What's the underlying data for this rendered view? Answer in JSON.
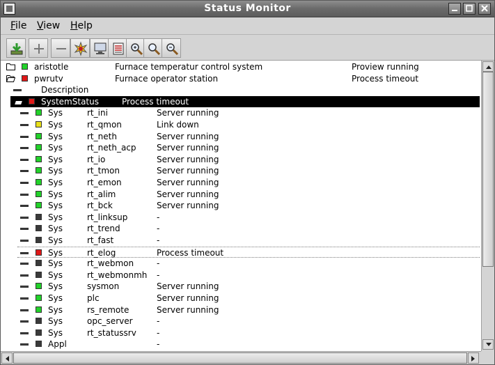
{
  "window": {
    "title": "Status Monitor"
  },
  "menu": {
    "file_label": "File",
    "view_label": "View",
    "help_label": "Help"
  },
  "toolbar": {
    "icons": [
      "save-icon",
      "add-icon",
      "remove-icon",
      "event-icon",
      "node-display-icon",
      "history-icon",
      "zoom-in-icon",
      "zoom-reset-icon",
      "zoom-out-icon"
    ]
  },
  "colors": {
    "green": "#22d22a",
    "red": "#e01818",
    "yellow": "#e8e01a",
    "gray": "#3a3a3a"
  },
  "nodes": [
    {
      "name": "aristotle",
      "description": "Furnace temperatur control system",
      "status": "Proview running",
      "color": "green",
      "expanded": false
    },
    {
      "name": "pwrutv",
      "description": "Furnace operator station",
      "status": "Process timeout",
      "color": "red",
      "expanded": true
    }
  ],
  "description_label": "Description",
  "system_status": {
    "label": "SystemStatus",
    "status": "Process timeout",
    "color": "red"
  },
  "servers": [
    {
      "type": "Sys",
      "name": "rt_ini",
      "status": "Server running",
      "color": "green"
    },
    {
      "type": "Sys",
      "name": "rt_qmon",
      "status": "Link down",
      "color": "yellow"
    },
    {
      "type": "Sys",
      "name": "rt_neth",
      "status": "Server running",
      "color": "green"
    },
    {
      "type": "Sys",
      "name": "rt_neth_acp",
      "status": "Server running",
      "color": "green"
    },
    {
      "type": "Sys",
      "name": "rt_io",
      "status": "Server running",
      "color": "green"
    },
    {
      "type": "Sys",
      "name": "rt_tmon",
      "status": "Server running",
      "color": "green"
    },
    {
      "type": "Sys",
      "name": "rt_emon",
      "status": "Server running",
      "color": "green"
    },
    {
      "type": "Sys",
      "name": "rt_alim",
      "status": "Server running",
      "color": "green"
    },
    {
      "type": "Sys",
      "name": "rt_bck",
      "status": "Server running",
      "color": "green"
    },
    {
      "type": "Sys",
      "name": "rt_linksup",
      "status": "-",
      "color": "gray"
    },
    {
      "type": "Sys",
      "name": "rt_trend",
      "status": "-",
      "color": "gray"
    },
    {
      "type": "Sys",
      "name": "rt_fast",
      "status": "-",
      "color": "gray"
    },
    {
      "type": "Sys",
      "name": "rt_elog",
      "status": "Process timeout",
      "color": "red",
      "focused": true
    },
    {
      "type": "Sys",
      "name": "rt_webmon",
      "status": "-",
      "color": "gray"
    },
    {
      "type": "Sys",
      "name": "rt_webmonmh",
      "status": "-",
      "color": "gray"
    },
    {
      "type": "Sys",
      "name": "sysmon",
      "status": "Server running",
      "color": "green"
    },
    {
      "type": "Sys",
      "name": "plc",
      "status": "Server running",
      "color": "green"
    },
    {
      "type": "Sys",
      "name": "rs_remote",
      "status": "Server running",
      "color": "green"
    },
    {
      "type": "Sys",
      "name": "opc_server",
      "status": "-",
      "color": "gray"
    },
    {
      "type": "Sys",
      "name": "rt_statussrv",
      "status": "-",
      "color": "gray"
    },
    {
      "type": "Appl",
      "name": "",
      "status": "-",
      "color": "gray"
    }
  ]
}
